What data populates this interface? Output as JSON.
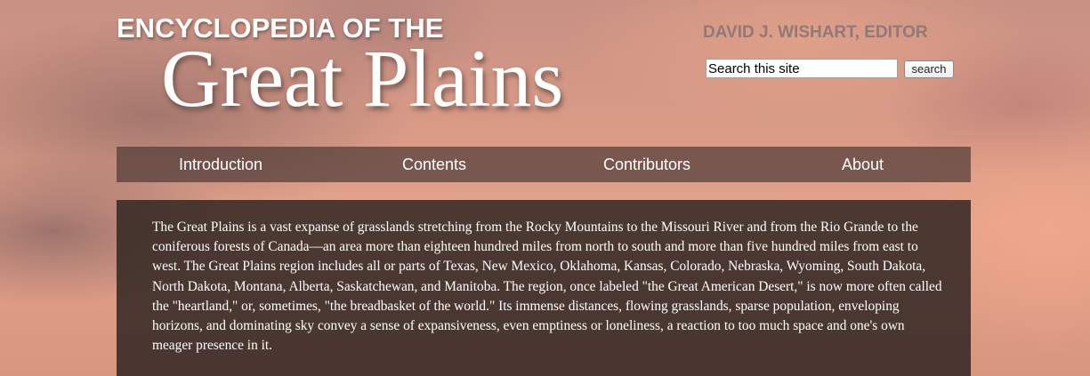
{
  "header": {
    "logo_top": "ENCYCLOPEDIA OF THE",
    "logo_main": "Great Plains",
    "editor": "DAVID J. WISHART, EDITOR"
  },
  "search": {
    "value": "Search this site",
    "button_label": "search"
  },
  "nav": {
    "items": [
      {
        "label": "Introduction"
      },
      {
        "label": "Contents"
      },
      {
        "label": "Contributors"
      },
      {
        "label": "About"
      }
    ]
  },
  "content": {
    "intro": "The Great Plains is a vast expanse of grasslands stretching from the Rocky Mountains to the Missouri River and from the Rio Grande to the coniferous forests of Canada—an area more than eighteen hundred miles from north to south and more than five hundred miles from east to west. The Great Plains region includes all or parts of Texas, New Mexico, Oklahoma, Kansas, Colorado, Nebraska, Wyoming, South Dakota, North Dakota, Montana, Alberta, Saskatchewan, and Manitoba. The region, once labeled \"the Great American Desert,\" is now more often called the \"heartland,\" or, sometimes, \"the breadbasket of the world.\" Its immense distances, flowing grasslands, sparse population, enveloping horizons, and dominating sky convey a sense of expansiveness, even emptiness or loneliness, a reaction to too much space and one's own meager presence in it."
  },
  "colors": {
    "nav_background": "#503c37",
    "content_background": "#32261f",
    "editor_text": "#8e7a77",
    "logo_text": "#ffffff"
  }
}
